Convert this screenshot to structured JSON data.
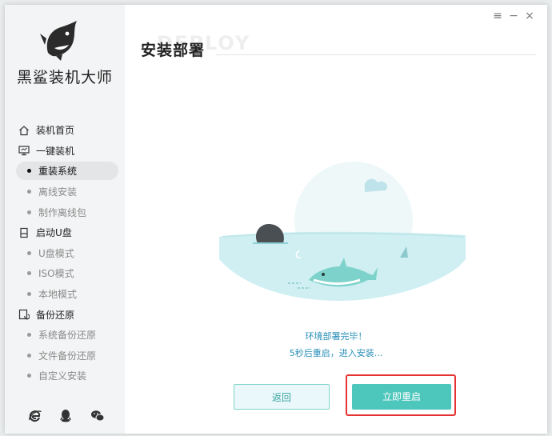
{
  "app": {
    "brand": "黑鲨装机大师"
  },
  "page": {
    "title": "安装部署",
    "title_watermark": "DEPLOY"
  },
  "window_controls": {
    "menu": "≡",
    "minimize": "−",
    "close": "×"
  },
  "sidebar": {
    "sections": [
      {
        "label": "装机首页",
        "icon": "home-icon"
      },
      {
        "label": "一键装机",
        "icon": "monitor-icon"
      },
      {
        "label": "启动U盘",
        "icon": "usb-icon"
      },
      {
        "label": "备份还原",
        "icon": "backup-icon"
      }
    ],
    "one_click_items": [
      "重装系统",
      "离线安装",
      "制作离线包"
    ],
    "usb_items": [
      "U盘模式",
      "ISO模式",
      "本地模式"
    ],
    "backup_items": [
      "系统备份还原",
      "文件备份还原",
      "自定义安装"
    ],
    "active_item": "重装系统",
    "bottom_icons": [
      "browser-icon",
      "qq-icon",
      "wechat-icon"
    ]
  },
  "status": {
    "line1": "环境部署完毕！",
    "line2": "5秒后重启，进入安装..."
  },
  "buttons": {
    "back": "返回",
    "restart": "立即重启"
  },
  "colors": {
    "accent": "#4dc6bc",
    "status_text": "#2a8fb8",
    "highlight": "#e53333"
  }
}
